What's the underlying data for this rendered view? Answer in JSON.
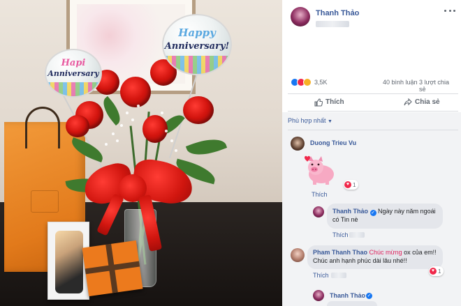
{
  "photo": {
    "balloon_left_line1": "Hapi",
    "balloon_left_line2": "Anniversary",
    "balloon_right_line1": "Happy",
    "balloon_right_line2": "Anniversary!"
  },
  "post": {
    "author": "Thanh Thảo",
    "reaction_count": "3,5K",
    "comment_count": "40 bình luận",
    "share_count": "3 lượt chia sẻ",
    "reaction_icons": [
      "like-icon",
      "love-icon",
      "wow-icon"
    ]
  },
  "actions": {
    "like_label": "Thích",
    "share_label": "Chia sẻ"
  },
  "comments": {
    "sort_label": "Phù hợp nhất",
    "items": [
      {
        "author": "Duong Trieu Vu",
        "sticker": "pink-pig-sticker",
        "like_label": "Thích",
        "reactions": "1"
      },
      {
        "author": "Thanh Thảo",
        "text": "Ngày này năm ngoái có Tin nè",
        "like_label": "Thích"
      },
      {
        "author": "Pham Thanh Thao",
        "highlight": "Chúc mừng",
        "text_after": "ox của em!! Chúc anh hạnh phúc dài lâu nhé!!",
        "like_label": "Thích",
        "reactions": "1"
      },
      {
        "author": "Thanh Thảo"
      }
    ]
  },
  "colors": {
    "link": "#385898",
    "like_blue": "#1877f2",
    "love_red": "#f0284a",
    "wow_yellow": "#f7b125",
    "comments_bg": "#f2f3f5"
  }
}
